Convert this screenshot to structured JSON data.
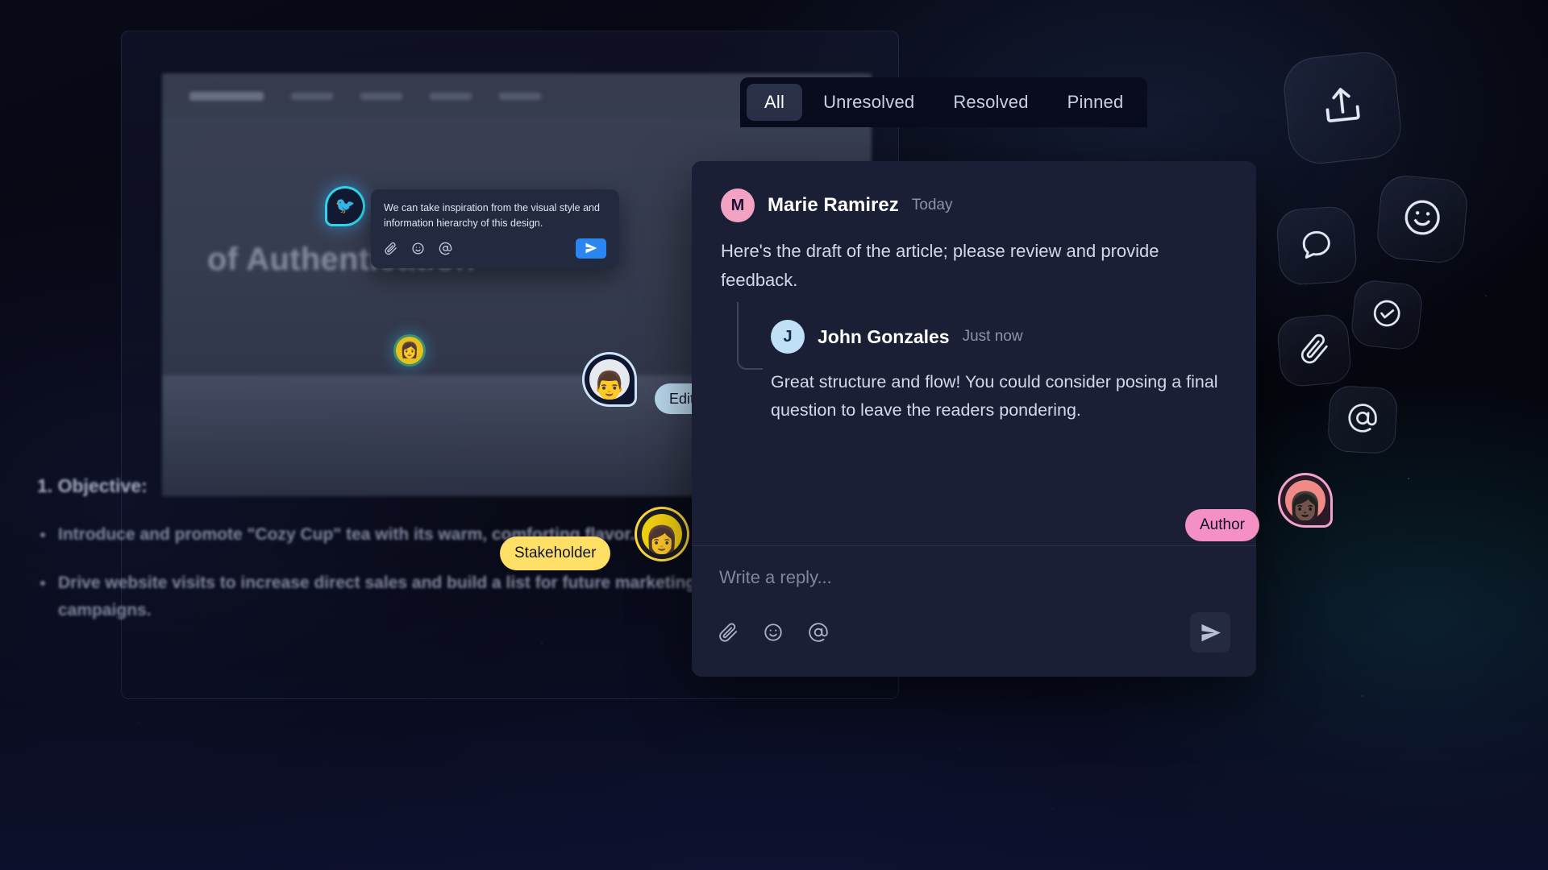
{
  "app": {
    "theme_background": "#05060f",
    "panel_background": "#1a1f35"
  },
  "document_canvas": {
    "headline": "of Authentication",
    "section_title": "1. Objective:",
    "bullets": [
      "Introduce and promote \"Cozy Cup\" tea with its warm, comforting flavor..",
      "Drive website visits to increase direct sales and build a list for future marketing campaigns."
    ]
  },
  "inline_comment": {
    "pin_icon": "map-pin-marker",
    "pin_emoji": "🐦",
    "text": "We can take inspiration from the visual style and information hierarchy of this design.",
    "tools": [
      {
        "name": "attach-icon",
        "label": "Attach"
      },
      {
        "name": "emoji-icon",
        "label": "Emoji"
      },
      {
        "name": "mention-icon",
        "label": "Mention"
      }
    ],
    "send_icon": "send-icon",
    "send_color": "#2a86f0"
  },
  "tabs": {
    "items": [
      {
        "label": "All",
        "active": true
      },
      {
        "label": "Unresolved",
        "active": false
      },
      {
        "label": "Resolved",
        "active": false
      },
      {
        "label": "Pinned",
        "active": false
      }
    ]
  },
  "thread": {
    "root": {
      "avatar_initial": "M",
      "avatar_color": "#f2a3c4",
      "author": "Marie Ramirez",
      "timestamp": "Today",
      "body": "Here's the draft of the article; please review and provide feedback."
    },
    "reply": {
      "avatar_initial": "J",
      "avatar_color": "#bfe0f5",
      "author": "John Gonzales",
      "timestamp": "Just now",
      "body": "Great structure and flow! You could consider posing a final question to leave the readers pondering."
    }
  },
  "reply_composer": {
    "placeholder": "Write a reply...",
    "value": "",
    "tools": [
      {
        "name": "attach-icon",
        "label": "Attach file"
      },
      {
        "name": "emoji-icon",
        "label": "Insert emoji"
      },
      {
        "name": "mention-icon",
        "label": "Mention someone"
      }
    ],
    "send_label": "Send"
  },
  "presence": [
    {
      "role_label": "Editor",
      "chip_color": "#bedcf2",
      "ring_color": "#cfe3f7",
      "avatar_emoji": "👨"
    },
    {
      "role_label": "Stakeholder",
      "chip_color": "#ffe066",
      "ring_color": "#ffd93d",
      "avatar_emoji": "👩"
    },
    {
      "role_label": "Author",
      "chip_color": "#f590c4",
      "ring_color": "#f2a3cd",
      "avatar_emoji": "👩🏿"
    }
  ],
  "floating_actions": [
    {
      "name": "share-icon",
      "label": "Share"
    },
    {
      "name": "smiley-icon",
      "label": "Reactions"
    },
    {
      "name": "chat-bubble-icon",
      "label": "Comment"
    },
    {
      "name": "check-circle-icon",
      "label": "Resolve"
    },
    {
      "name": "paperclip-icon",
      "label": "Attach"
    },
    {
      "name": "at-sign-icon",
      "label": "Mention"
    }
  ]
}
